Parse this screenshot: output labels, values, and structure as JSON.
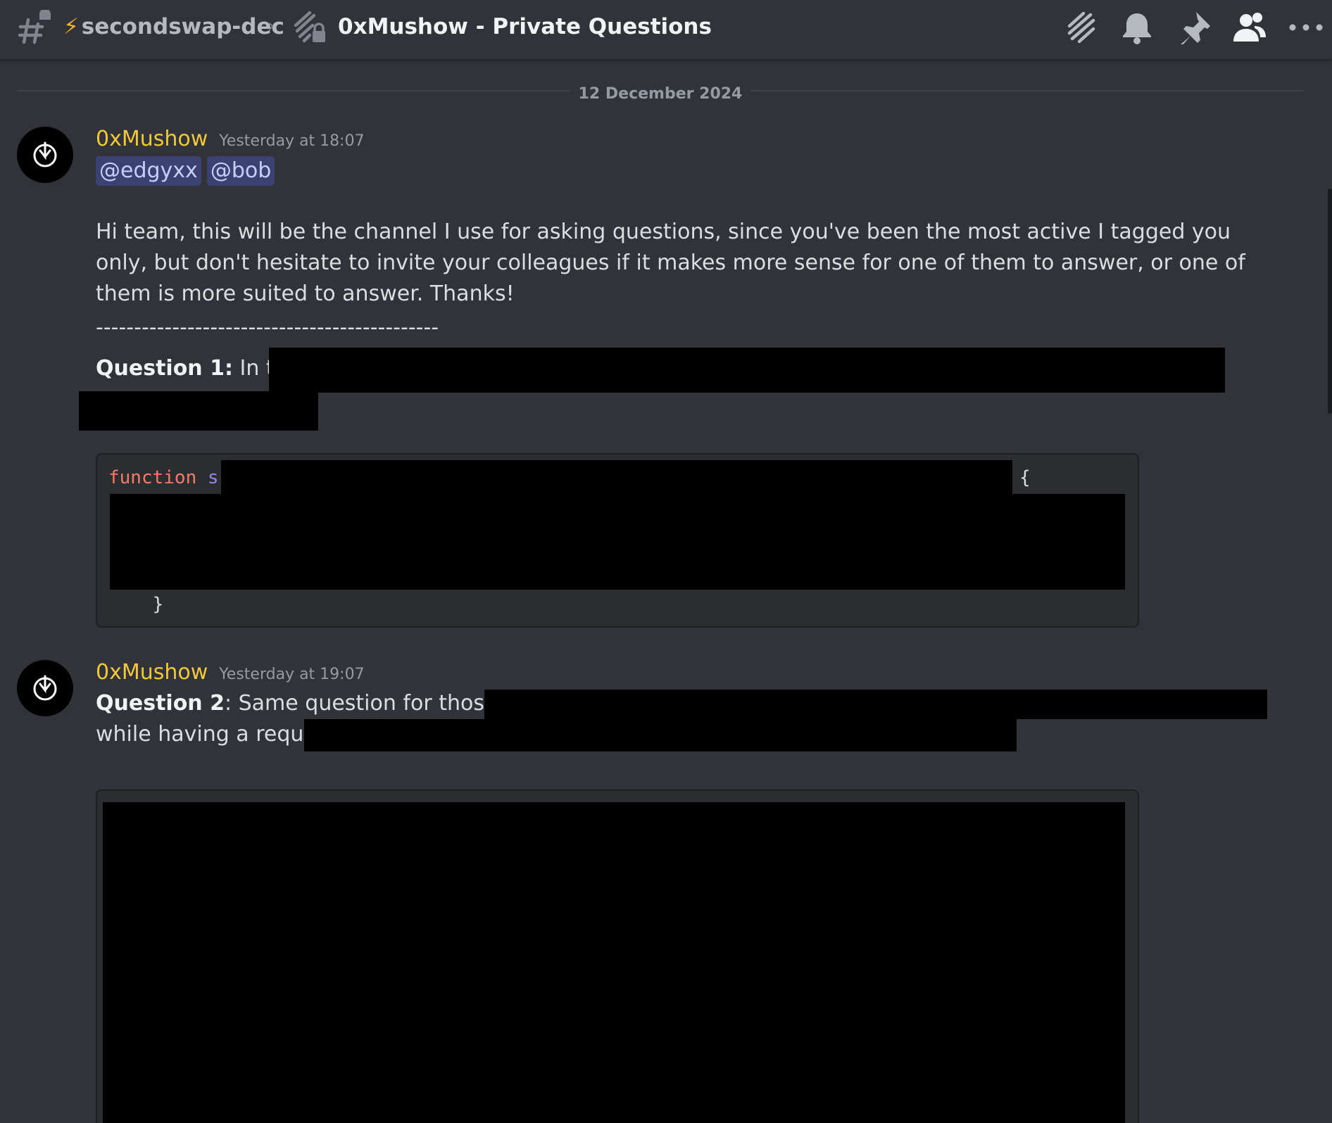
{
  "header": {
    "channel_bolt": "⚡",
    "channel_name": "secondswap-dec",
    "separator": "›",
    "thread_title": "0xMushow - Private Questions",
    "tools": [
      {
        "name": "threads-icon",
        "label": "Threads"
      },
      {
        "name": "bell-icon",
        "label": "Notification Settings"
      },
      {
        "name": "pin-icon",
        "label": "Pinned Messages"
      },
      {
        "name": "members-icon",
        "label": "Member List"
      },
      {
        "name": "more-icon",
        "label": "More"
      }
    ]
  },
  "divider": {
    "date": "12 December 2024"
  },
  "messages": [
    {
      "author": "0xMushow",
      "timestamp": "Yesterday at 18:07",
      "mentions": [
        "@edgyxx",
        "@bob"
      ],
      "body": "Hi team, this will be the channel I use for asking questions, since you've been the most active I tagged you only, but don't hesitate to invite your colleagues if it makes more sense for one of them to answer, or one of them is more suited to answer. Thanks!",
      "dashes": "---------------------------------------------",
      "question_label": "Question 1:",
      "question_text": " In the",
      "code": {
        "keyword": "function",
        "name_start": " s",
        "open_brace": "{",
        "close_brace": "    }"
      }
    },
    {
      "author": "0xMushow",
      "timestamp": "Yesterday at 19:07",
      "question_label": "Question 2",
      "question_text": ":  Same question for those two",
      "second_line": "while having a require"
    }
  ],
  "colors": {
    "background": "#313338",
    "username": "#f0c83c",
    "mention_bg": "#3c4270",
    "mention_text": "#c9cdfb",
    "code_bg": "#2b2d31",
    "keyword": "#f47b67",
    "function_name": "#9c84ef"
  }
}
